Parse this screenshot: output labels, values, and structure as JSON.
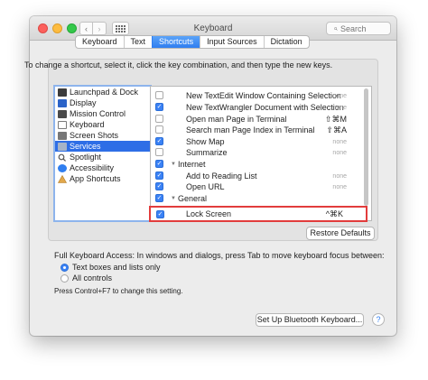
{
  "window": {
    "title": "Keyboard"
  },
  "toolbar": {
    "back_icon": "‹",
    "forward_icon": "›",
    "search_placeholder": "Search"
  },
  "tabs": [
    {
      "label": "Keyboard",
      "active": false
    },
    {
      "label": "Text",
      "active": false
    },
    {
      "label": "Shortcuts",
      "active": true
    },
    {
      "label": "Input Sources",
      "active": false
    },
    {
      "label": "Dictation",
      "active": false
    }
  ],
  "instructions": "To change a shortcut, select it, click the key combination, and then type the new keys.",
  "categories": [
    {
      "label": "Launchpad & Dock",
      "icon": "launchpad-icon",
      "selected": false
    },
    {
      "label": "Display",
      "icon": "display-icon",
      "selected": false
    },
    {
      "label": "Mission Control",
      "icon": "mission-control-icon",
      "selected": false
    },
    {
      "label": "Keyboard",
      "icon": "keyboard-icon",
      "selected": false
    },
    {
      "label": "Screen Shots",
      "icon": "screenshots-icon",
      "selected": false
    },
    {
      "label": "Services",
      "icon": "services-icon",
      "selected": true
    },
    {
      "label": "Spotlight",
      "icon": "spotlight-icon",
      "selected": false
    },
    {
      "label": "Accessibility",
      "icon": "accessibility-icon",
      "selected": false
    },
    {
      "label": "App Shortcuts",
      "icon": "app-shortcuts-icon",
      "selected": false
    }
  ],
  "shortcuts": [
    {
      "kind": "item",
      "label": "New TextEdit Window Containing Selection",
      "key": "none",
      "checked": false
    },
    {
      "kind": "item",
      "label": "New TextWrangler Document with Selection",
      "key": "none",
      "checked": true
    },
    {
      "kind": "item",
      "label": "Open man Page in Terminal",
      "key": "⇧⌘M",
      "checked": false
    },
    {
      "kind": "item",
      "label": "Search man Page Index in Terminal",
      "key": "⇧⌘A",
      "checked": false
    },
    {
      "kind": "item",
      "label": "Show Map",
      "key": "none",
      "checked": true
    },
    {
      "kind": "item",
      "label": "Summarize",
      "key": "none",
      "checked": false
    },
    {
      "kind": "group",
      "label": "Internet",
      "checked": true
    },
    {
      "kind": "item",
      "label": "Add to Reading List",
      "key": "none",
      "checked": true
    },
    {
      "kind": "item",
      "label": "Open URL",
      "key": "none",
      "checked": true
    },
    {
      "kind": "group",
      "label": "General",
      "checked": true
    }
  ],
  "highlighted": {
    "label": "Lock Screen",
    "key": "^⌘K",
    "checked": true
  },
  "buttons": {
    "restore": "Restore Defaults",
    "bluetooth": "Set Up Bluetooth Keyboard...",
    "help": "?"
  },
  "full_keyboard_access": {
    "label": "Full Keyboard Access: In windows and dialogs, press Tab to move keyboard focus between:",
    "options": [
      {
        "label": "Text boxes and lists only",
        "selected": true
      },
      {
        "label": "All controls",
        "selected": false
      }
    ],
    "hint": "Press Control+F7 to change this setting."
  }
}
